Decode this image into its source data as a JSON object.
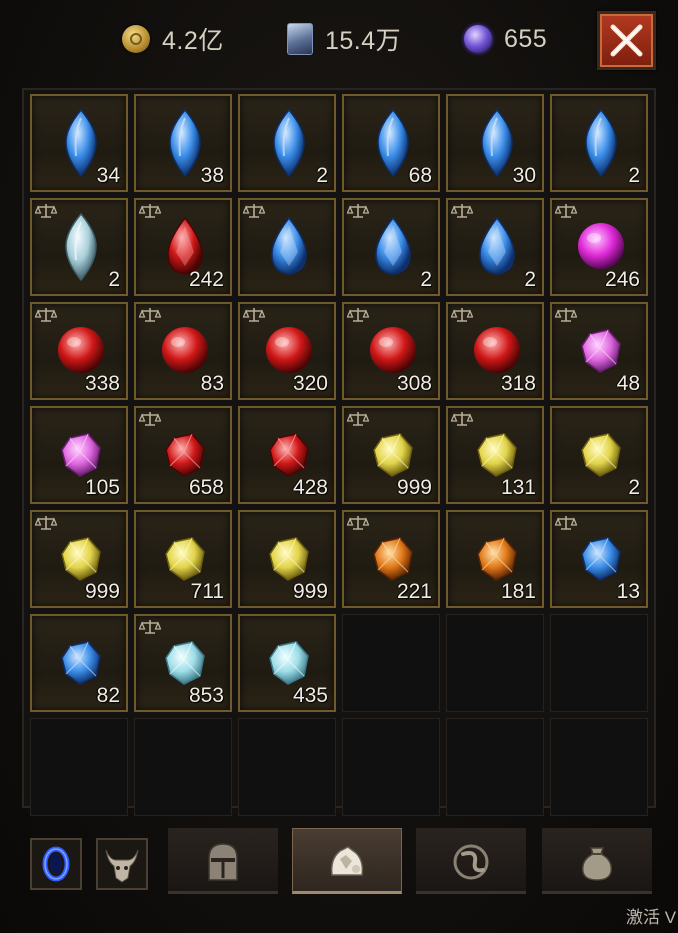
{
  "currency": {
    "gold": {
      "icon": "gold-coin-icon",
      "value": "4.2亿"
    },
    "scroll": {
      "icon": "scroll-icon",
      "value": "15.4万"
    },
    "orb": {
      "icon": "purple-orb-icon",
      "value": "655"
    }
  },
  "close_icon": "close-x-icon",
  "inventory": {
    "columns": 6,
    "rows": 7,
    "items": [
      {
        "gem": "blue-marquise",
        "qty": "34",
        "tradable": false
      },
      {
        "gem": "blue-marquise",
        "qty": "38",
        "tradable": false
      },
      {
        "gem": "blue-marquise",
        "qty": "2",
        "tradable": false
      },
      {
        "gem": "blue-marquise",
        "qty": "68",
        "tradable": false
      },
      {
        "gem": "blue-marquise",
        "qty": "30",
        "tradable": false
      },
      {
        "gem": "blue-marquise",
        "qty": "2",
        "tradable": false
      },
      {
        "gem": "white-marquise",
        "qty": "2",
        "tradable": true
      },
      {
        "gem": "red-teardrop",
        "qty": "242",
        "tradable": true
      },
      {
        "gem": "blue-teardrop",
        "qty": "",
        "tradable": true
      },
      {
        "gem": "blue-teardrop",
        "qty": "2",
        "tradable": true
      },
      {
        "gem": "blue-teardrop",
        "qty": "2",
        "tradable": true
      },
      {
        "gem": "magenta-sphere",
        "qty": "246",
        "tradable": true
      },
      {
        "gem": "red-sphere",
        "qty": "338",
        "tradable": true
      },
      {
        "gem": "red-sphere",
        "qty": "83",
        "tradable": true
      },
      {
        "gem": "red-sphere",
        "qty": "320",
        "tradable": true
      },
      {
        "gem": "red-sphere",
        "qty": "308",
        "tradable": true
      },
      {
        "gem": "red-sphere",
        "qty": "318",
        "tradable": true
      },
      {
        "gem": "pink-rough",
        "qty": "48",
        "tradable": true
      },
      {
        "gem": "pink-rough",
        "qty": "105",
        "tradable": false
      },
      {
        "gem": "red-rough",
        "qty": "658",
        "tradable": true
      },
      {
        "gem": "red-rough",
        "qty": "428",
        "tradable": false
      },
      {
        "gem": "yellow-rough",
        "qty": "999",
        "tradable": true
      },
      {
        "gem": "yellow-rough",
        "qty": "131",
        "tradable": true
      },
      {
        "gem": "yellow-rough",
        "qty": "2",
        "tradable": false
      },
      {
        "gem": "yellow-rough",
        "qty": "999",
        "tradable": true
      },
      {
        "gem": "yellow-rough",
        "qty": "711",
        "tradable": false
      },
      {
        "gem": "yellow-rough",
        "qty": "999",
        "tradable": false
      },
      {
        "gem": "orange-rough",
        "qty": "221",
        "tradable": true
      },
      {
        "gem": "orange-rough",
        "qty": "181",
        "tradable": false
      },
      {
        "gem": "blue-rough",
        "qty": "13",
        "tradable": true
      },
      {
        "gem": "blue-rough",
        "qty": "82",
        "tradable": false
      },
      {
        "gem": "cyan-rough",
        "qty": "853",
        "tradable": true
      },
      {
        "gem": "cyan-rough",
        "qty": "435",
        "tradable": false
      }
    ]
  },
  "bottom_bar": {
    "buttons": [
      {
        "icon": "blue-portal-icon"
      },
      {
        "icon": "horned-demon-icon"
      }
    ],
    "tabs": [
      {
        "icon": "knight-helmet-icon",
        "active": false
      },
      {
        "icon": "gem-bag-icon",
        "active": true
      },
      {
        "icon": "rune-sigil-icon",
        "active": false
      },
      {
        "icon": "loot-sack-icon",
        "active": false
      }
    ]
  },
  "watermark": "激活 V"
}
